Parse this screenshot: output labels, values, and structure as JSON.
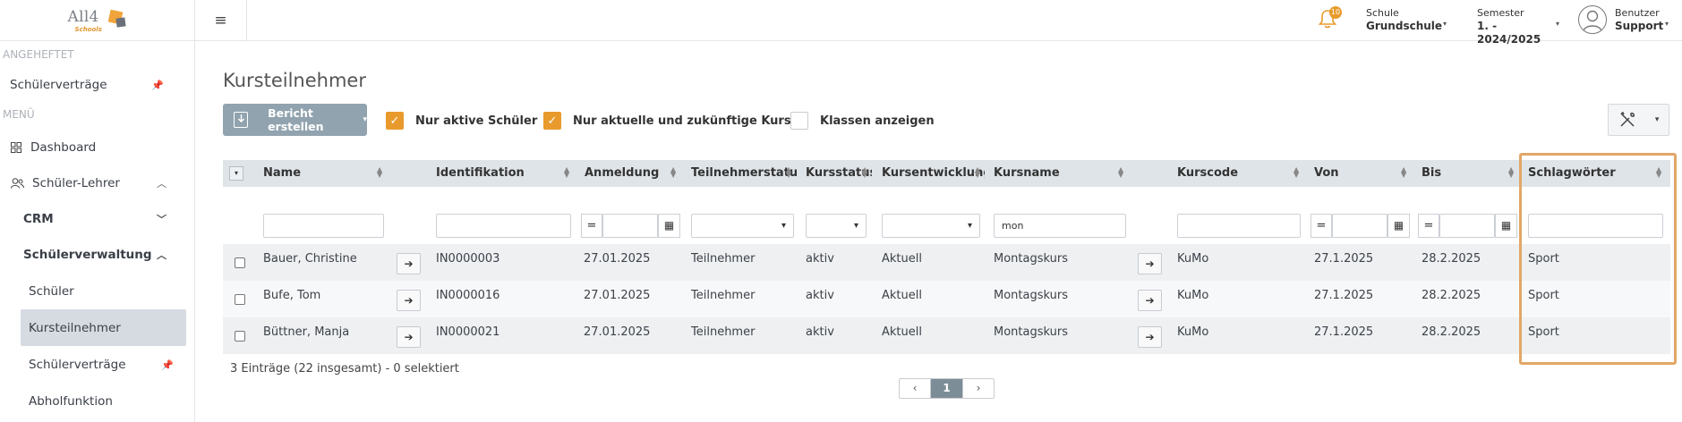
{
  "brand": {
    "name": "All4",
    "sub": "Schools"
  },
  "sidebar": {
    "pinned_label": "ANGEHEFTET",
    "pinned_items": [
      {
        "label": "Schülerverträge"
      }
    ],
    "menu_label": "MENÜ",
    "dashboard": "Dashboard",
    "schueler_lehrer": "Schüler-Lehrer",
    "crm": "CRM",
    "schuelerverwaltung": "Schülerverwaltung",
    "sub_items": [
      {
        "label": "Schüler"
      },
      {
        "label": "Kursteilnehmer"
      },
      {
        "label": "Schülerverträge"
      },
      {
        "label": "Abholfunktion"
      }
    ]
  },
  "topbar": {
    "notifications": "10",
    "schule_label": "Schule",
    "schule_value": "Grundschule",
    "semester_label": "Semester",
    "semester_value": "1. - 2024/2025",
    "benutzer_label": "Benutzer",
    "benutzer_value": "Support"
  },
  "page": {
    "title": "Kursteilnehmer",
    "report_button": "Bericht erstellen",
    "options": [
      {
        "label": "Nur aktive Schüler",
        "checked": true
      },
      {
        "label": "Nur aktuelle und zukünftige Kurse",
        "checked": true
      },
      {
        "label": "Klassen anzeigen",
        "checked": false
      }
    ]
  },
  "table": {
    "columns": [
      "Name",
      "Identifikation",
      "Anmeldung",
      "Teilnehmerstatus",
      "Kursstatus",
      "Kursentwicklung",
      "Kursname",
      "Kurscode",
      "Von",
      "Bis",
      "Schlagwörter"
    ],
    "filters": {
      "kursname": "mon",
      "anmeldung_op": "=",
      "von_op": "=",
      "bis_op": "="
    },
    "rows": [
      {
        "name": "Bauer, Christine",
        "id": "IN0000003",
        "anmeldung": "27.01.2025",
        "teilnehmerstatus": "Teilnehmer",
        "kursstatus": "aktiv",
        "kursentwicklung": "Aktuell",
        "kursname": "Montagskurs",
        "kurscode": "KuMo",
        "von": "27.1.2025",
        "bis": "28.2.2025",
        "schlagwoerter": "Sport"
      },
      {
        "name": "Bufe, Tom",
        "id": "IN0000016",
        "anmeldung": "27.01.2025",
        "teilnehmerstatus": "Teilnehmer",
        "kursstatus": "aktiv",
        "kursentwicklung": "Aktuell",
        "kursname": "Montagskurs",
        "kurscode": "KuMo",
        "von": "27.1.2025",
        "bis": "28.2.2025",
        "schlagwoerter": "Sport"
      },
      {
        "name": "Büttner, Manja",
        "id": "IN0000021",
        "anmeldung": "27.01.2025",
        "teilnehmerstatus": "Teilnehmer",
        "kursstatus": "aktiv",
        "kursentwicklung": "Aktuell",
        "kursname": "Montagskurs",
        "kurscode": "KuMo",
        "von": "27.1.2025",
        "bis": "28.2.2025",
        "schlagwoerter": "Sport"
      }
    ],
    "summary": "3 Einträge (22 insgesamt) - 0 selektiert"
  },
  "pager": {
    "prev": "‹",
    "current": "1",
    "next": "›"
  },
  "colors": {
    "accent": "#e89a2c",
    "button": "#91a3ae",
    "header_bg": "#dfe4e8",
    "active_nav": "#d5dbe1",
    "highlight": "#e2a767"
  }
}
